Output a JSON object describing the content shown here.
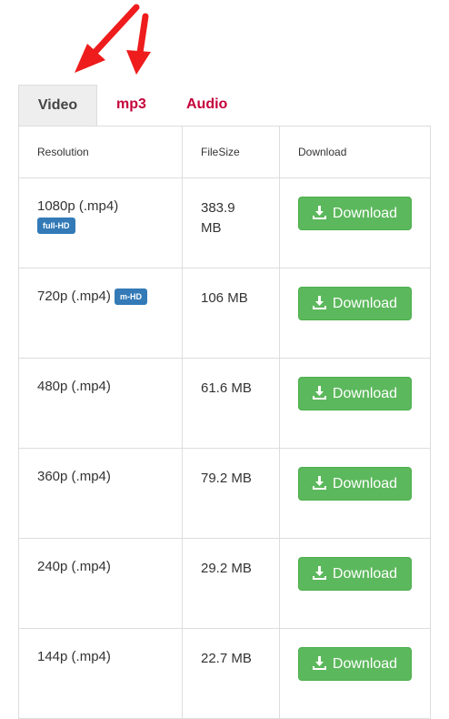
{
  "colors": {
    "accent": "#c5003b",
    "button": "#5cb85c",
    "badge": "#337ab7",
    "annotation_arrow": "#ee1c1c"
  },
  "tabs": [
    {
      "label": "Video",
      "active": true
    },
    {
      "label": "mp3",
      "active": false
    },
    {
      "label": "Audio",
      "active": false
    }
  ],
  "table": {
    "headers": {
      "resolution": "Resolution",
      "filesize": "FileSize",
      "download": "Download"
    },
    "download_label": "Download",
    "rows": [
      {
        "resolution": "1080p (.mp4)",
        "badge": "full-HD",
        "size": "383.9 MB"
      },
      {
        "resolution": "720p (.mp4)",
        "badge": "m-HD",
        "size": "106 MB"
      },
      {
        "resolution": "480p (.mp4)",
        "size": "61.6 MB"
      },
      {
        "resolution": "360p (.mp4)",
        "size": "79.2 MB"
      },
      {
        "resolution": "240p (.mp4)",
        "size": "29.2 MB"
      },
      {
        "resolution": "144p (.mp4)",
        "size": "22.7 MB"
      }
    ]
  }
}
